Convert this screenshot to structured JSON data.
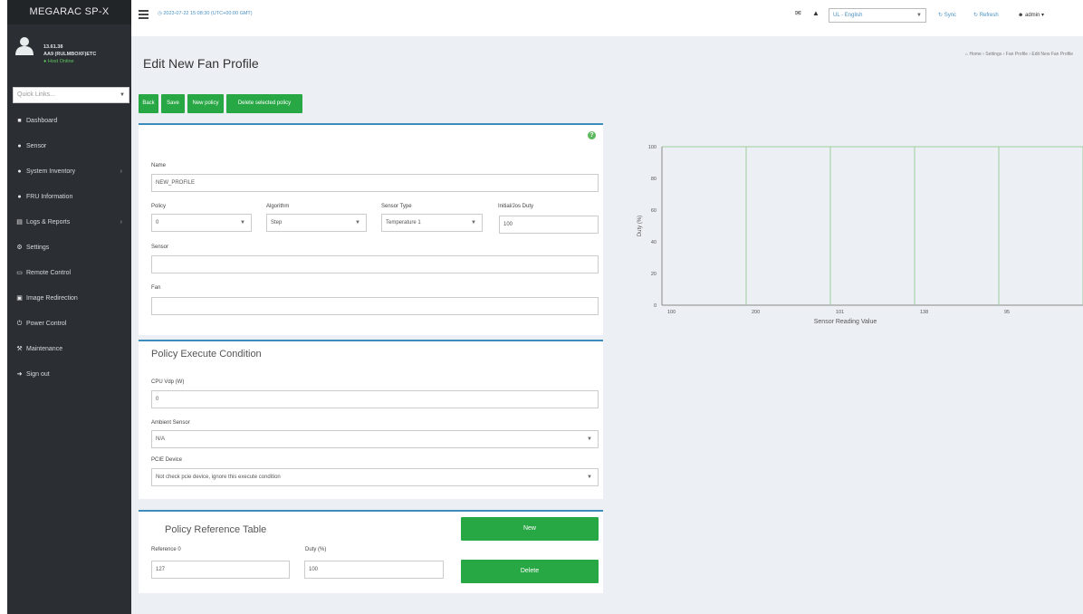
{
  "sidebar": {
    "brand": "MEGARAC SP-X",
    "user_line1": "13.61.38",
    "user_line2": "AA9 (RULMBOXF)ETC",
    "user_status": "Host Online",
    "quicklinks_placeholder": "Quick Links...",
    "items": [
      {
        "label": "Dashboard",
        "icon": "dashboard-icon",
        "glyph": "■",
        "arrow": ""
      },
      {
        "label": "Sensor",
        "icon": "sensor-icon",
        "glyph": "●",
        "arrow": ""
      },
      {
        "label": "System Inventory",
        "icon": "inventory-icon",
        "glyph": "●",
        "arrow": "›"
      },
      {
        "label": "FRU Information",
        "icon": "fru-icon",
        "glyph": "●",
        "arrow": ""
      },
      {
        "label": "Logs & Reports",
        "icon": "chart-icon",
        "glyph": "▤",
        "arrow": "›"
      },
      {
        "label": "Settings",
        "icon": "gear-icon",
        "glyph": "⚙",
        "arrow": ""
      },
      {
        "label": "Remote Control",
        "icon": "monitor-icon",
        "glyph": "▭",
        "arrow": ""
      },
      {
        "label": "Image Redirection",
        "icon": "image-icon",
        "glyph": "▣",
        "arrow": ""
      },
      {
        "label": "Power Control",
        "icon": "power-icon",
        "glyph": "⏻",
        "arrow": ""
      },
      {
        "label": "Maintenance",
        "icon": "wrench-icon",
        "glyph": "⚒",
        "arrow": ""
      },
      {
        "label": "Sign out",
        "icon": "signout-icon",
        "glyph": "➜",
        "arrow": ""
      }
    ]
  },
  "header": {
    "datetime": "2023-07-22 15:08:30 (UTC+00:00 GMT)",
    "language": "UL - English",
    "sync_label": "Sync",
    "refresh_label": "Refresh",
    "user_label": "admin"
  },
  "page": {
    "title": "Edit New Fan Profile",
    "breadcrumb": [
      "Home",
      "Settings",
      "Fan Profile",
      "Edit New Fan Profile"
    ]
  },
  "buttons": {
    "back": "Back",
    "save": "Save",
    "new_policy": "New policy",
    "delete_policy": "Delete selected policy"
  },
  "form": {
    "name_label": "Name",
    "name_value": "NEW_PROFILE",
    "policy_label": "Policy",
    "policy_value": "0",
    "algorithm_label": "Algorithm",
    "algorithm_value": "Step",
    "sensor_type_label": "Sensor Type",
    "sensor_type_value": "Temperature 1",
    "initial_duty_label": "Initial/Jos Duty",
    "initial_duty_value": "100",
    "sensor_label": "Sensor",
    "sensor_value": "",
    "fan_label": "Fan",
    "fan_value": ""
  },
  "condition": {
    "title": "Policy Execute Condition",
    "cpu_label": "CPU Vdp (W)",
    "cpu_value": "0",
    "ambient_label": "Ambient Sensor",
    "ambient_value": "N/A",
    "pcie_label": "PCIE Device",
    "pcie_value": "Not check pcie device, ignore this execute condition"
  },
  "reference": {
    "title": "Policy Reference Table",
    "ref_label": "Reference 0",
    "ref_value": "127",
    "duty_label": "Duty (%)",
    "duty_value": "100",
    "new_label": "New",
    "delete_label": "Delete"
  },
  "chart_data": {
    "type": "line",
    "xlabel": "Sensor Reading Value",
    "ylabel": "Duty (%)",
    "x_ticks": [
      "100",
      "200",
      "101",
      "138",
      "95"
    ],
    "y_ticks": [
      0,
      20,
      40,
      60,
      80,
      100
    ],
    "ylim": [
      0,
      100
    ],
    "grid": true,
    "series": [],
    "colors": {
      "grid": "#9ccc9c",
      "axis": "#888888"
    }
  },
  "colors": {
    "accent": "#28a745",
    "sidebar": "#2b2f33",
    "link": "#4a90c2",
    "card_border": "#3c8dbc"
  }
}
